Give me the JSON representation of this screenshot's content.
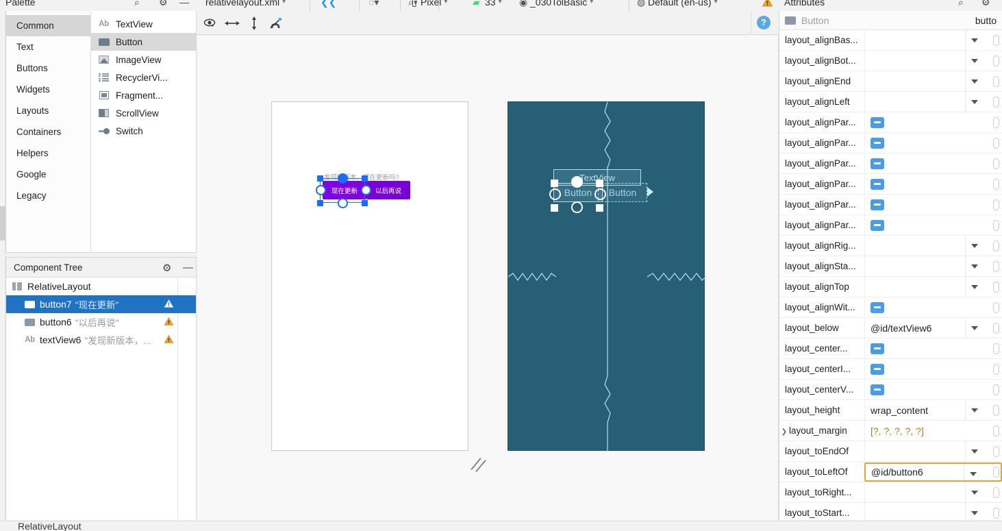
{
  "top_toolbar": {
    "file_tab": "relativelayout.xml",
    "design_mode_icon": "design-surface-icon",
    "blueprint_icon": "blueprint-toggle-icon",
    "zoom_icon": "zoom-icon",
    "device": "Pixel",
    "api_level": "33",
    "theme": "_030TolBasic",
    "locale": "Default (en-us)",
    "warning_icon": "warning-triangle-icon"
  },
  "palette": {
    "title": "Palette",
    "search_icon": "search-icon",
    "gear_icon": "gear-icon",
    "minimize_icon": "minimize-icon",
    "categories": [
      {
        "label": "Common",
        "selected": true
      },
      {
        "label": "Text",
        "selected": false
      },
      {
        "label": "Buttons",
        "selected": false
      },
      {
        "label": "Widgets",
        "selected": false
      },
      {
        "label": "Layouts",
        "selected": false
      },
      {
        "label": "Containers",
        "selected": false
      },
      {
        "label": "Helpers",
        "selected": false
      },
      {
        "label": "Google",
        "selected": false
      },
      {
        "label": "Legacy",
        "selected": false
      }
    ],
    "items": [
      {
        "label": "TextView",
        "icon": "ab-text-icon",
        "selected": false
      },
      {
        "label": "Button",
        "icon": "button-icon",
        "selected": true
      },
      {
        "label": "ImageView",
        "icon": "image-icon",
        "selected": false
      },
      {
        "label": "RecyclerVi...",
        "icon": "list-icon",
        "selected": false
      },
      {
        "label": "Fragment...",
        "icon": "fragment-icon",
        "selected": false
      },
      {
        "label": "ScrollView",
        "icon": "scrollview-icon",
        "selected": false
      },
      {
        "label": "Switch",
        "icon": "switch-icon",
        "selected": false
      }
    ]
  },
  "component_tree": {
    "title": "Component Tree",
    "gear_icon": "gear-icon",
    "minimize_icon": "minimize-icon",
    "rows": [
      {
        "name": "RelativeLayout",
        "value": "",
        "icon": "layout-icon",
        "indent": 0,
        "selected": false,
        "warning": false
      },
      {
        "name": "button7",
        "value": "\"现在更新\"",
        "icon": "button-icon",
        "indent": 1,
        "selected": true,
        "warning": true
      },
      {
        "name": "button6",
        "value": "\"以后再说\"",
        "icon": "button-icon",
        "indent": 1,
        "selected": false,
        "warning": true
      },
      {
        "name": "textView6",
        "value": "\"发现新版本，...",
        "icon": "ab-text-icon",
        "indent": 1,
        "selected": false,
        "warning": true
      }
    ]
  },
  "design_toolbar": {
    "view_options_icon": "eye-icon",
    "horizontal_guide_icon": "horizontal-arrows-icon",
    "vertical_guide_icon": "vertical-arrows-icon",
    "autoconnect_icon": "magnet-off-icon",
    "help_icon": "help-icon",
    "help_label": "?"
  },
  "canvas": {
    "design_preview": {
      "textview_text": "发现新版本，现在更新吗?",
      "button_primary": "现在更新",
      "button_secondary": "以后再说"
    },
    "blueprint_preview": {
      "textview_label": "TextView",
      "button_primary_label": "Button",
      "button_secondary_label": "Button"
    },
    "resize_handle_icon": "resize-handle-icon"
  },
  "attributes": {
    "title": "Attributes",
    "search_icon": "search-icon",
    "gear_icon": "gear-icon",
    "component_type": "Button",
    "component_id": "butto",
    "rows": [
      {
        "name": "layout_alignBas...",
        "value": "",
        "control": "dropdown",
        "expandable": false,
        "focused": false
      },
      {
        "name": "layout_alignBot...",
        "value": "",
        "control": "dropdown",
        "expandable": false,
        "focused": false
      },
      {
        "name": "layout_alignEnd",
        "value": "",
        "control": "dropdown",
        "expandable": false,
        "focused": false
      },
      {
        "name": "layout_alignLeft",
        "value": "",
        "control": "dropdown",
        "expandable": false,
        "focused": false
      },
      {
        "name": "layout_alignPar...",
        "value": "",
        "control": "checkbox",
        "expandable": false,
        "focused": false
      },
      {
        "name": "layout_alignPar...",
        "value": "",
        "control": "checkbox",
        "expandable": false,
        "focused": false
      },
      {
        "name": "layout_alignPar...",
        "value": "",
        "control": "checkbox",
        "expandable": false,
        "focused": false
      },
      {
        "name": "layout_alignPar...",
        "value": "",
        "control": "checkbox",
        "expandable": false,
        "focused": false
      },
      {
        "name": "layout_alignPar...",
        "value": "",
        "control": "checkbox",
        "expandable": false,
        "focused": false
      },
      {
        "name": "layout_alignPar...",
        "value": "",
        "control": "checkbox",
        "expandable": false,
        "focused": false
      },
      {
        "name": "layout_alignRig...",
        "value": "",
        "control": "dropdown",
        "expandable": false,
        "focused": false
      },
      {
        "name": "layout_alignSta...",
        "value": "",
        "control": "dropdown",
        "expandable": false,
        "focused": false
      },
      {
        "name": "layout_alignTop",
        "value": "",
        "control": "dropdown",
        "expandable": false,
        "focused": false
      },
      {
        "name": "layout_alignWit...",
        "value": "",
        "control": "checkbox",
        "expandable": false,
        "focused": false
      },
      {
        "name": "layout_below",
        "value": "@id/textView6",
        "control": "dropdown",
        "expandable": false,
        "focused": false
      },
      {
        "name": "layout_center...",
        "value": "",
        "control": "checkbox",
        "expandable": false,
        "focused": false
      },
      {
        "name": "layout_centerI...",
        "value": "",
        "control": "checkbox",
        "expandable": false,
        "focused": false
      },
      {
        "name": "layout_centerV...",
        "value": "",
        "control": "checkbox",
        "expandable": false,
        "focused": false
      },
      {
        "name": "layout_height",
        "value": "wrap_content",
        "control": "dropdown",
        "expandable": false,
        "focused": false
      },
      {
        "name": "layout_margin",
        "value": "[?, ?, ?, ?, ?]",
        "control": "text-orange",
        "expandable": true,
        "focused": false
      },
      {
        "name": "layout_toEndOf",
        "value": "",
        "control": "dropdown",
        "expandable": false,
        "focused": false
      },
      {
        "name": "layout_toLeftOf",
        "value": "@id/button6",
        "control": "dropdown",
        "expandable": false,
        "focused": true
      },
      {
        "name": "layout_toRight...",
        "value": "",
        "control": "dropdown",
        "expandable": false,
        "focused": false
      },
      {
        "name": "layout_toStart...",
        "value": "",
        "control": "dropdown",
        "expandable": false,
        "focused": false
      }
    ]
  },
  "status_bar": {
    "breadcrumb": "RelativeLayout"
  },
  "colors": {
    "selection_blue": "#1f72c4",
    "blueprint_bg": "#265f76",
    "accent_purple": "#7f00e0",
    "focus_orange": "#e8a33d",
    "checkbox_blue": "#4a9be8"
  }
}
